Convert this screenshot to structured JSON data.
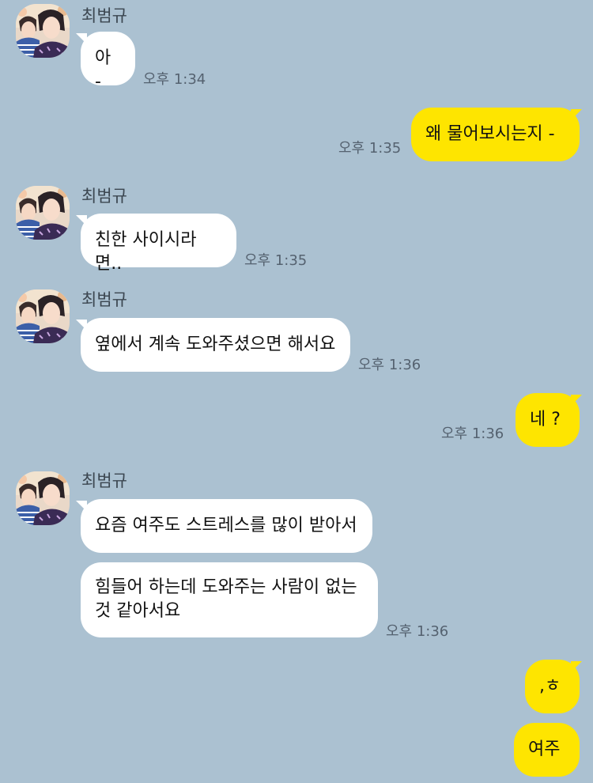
{
  "chat": {
    "messages": [
      {
        "sender": "최범규",
        "text": "아 -",
        "time": "오후 1:34",
        "direction": "in"
      },
      {
        "text": "왜 물어보시는지 -",
        "time": "오후 1:35",
        "direction": "out"
      },
      {
        "sender": "최범규",
        "text": "친한 사이시라면..",
        "time": "오후 1:35",
        "direction": "in"
      },
      {
        "sender": "최범규",
        "text": "옆에서 계속 도와주셨으면 해서요",
        "time": "오후 1:36",
        "direction": "in"
      },
      {
        "text": "네 ?",
        "time": "오후 1:36",
        "direction": "out"
      },
      {
        "sender": "최범규",
        "text": "요즘 여주도 스트레스를 많이 받아서",
        "direction": "in"
      },
      {
        "text": "힘들어 하는데 도와주는 사람이 없는\n것 같아서요",
        "time": "오후 1:36",
        "direction": "in"
      },
      {
        "text": ",ㅎ",
        "direction": "out"
      },
      {
        "text": "여주",
        "direction": "out"
      }
    ]
  },
  "colors": {
    "background": "#abc1d1",
    "incoming_bubble": "#ffffff",
    "outgoing_bubble": "#fee500"
  },
  "icons": {
    "avatar": "profile-photo"
  }
}
